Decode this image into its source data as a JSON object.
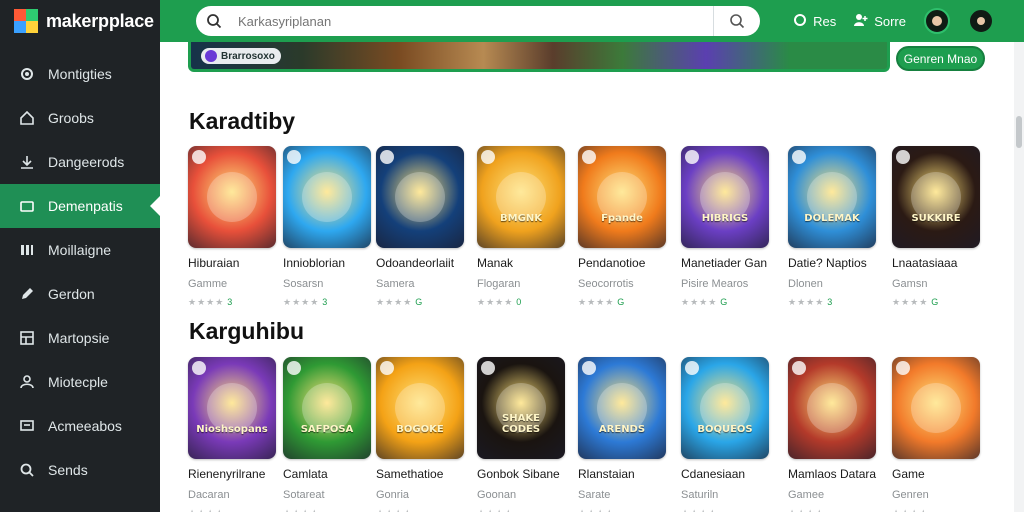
{
  "brand": {
    "name": "makerpplace"
  },
  "sidebar": {
    "items": [
      {
        "label": "Montigties",
        "icon": "settings-icon"
      },
      {
        "label": "Groobs",
        "icon": "home-icon"
      },
      {
        "label": "Dangeerods",
        "icon": "download-icon"
      },
      {
        "label": "Demenpatis",
        "icon": "folder-icon",
        "active": true
      },
      {
        "label": "Moillaigne",
        "icon": "library-icon"
      },
      {
        "label": "Gerdon",
        "icon": "pen-icon"
      },
      {
        "label": "Martopsie",
        "icon": "grid-icon"
      },
      {
        "label": "Miotecple",
        "icon": "people-icon"
      },
      {
        "label": "Acmeeabos",
        "icon": "chat-icon"
      },
      {
        "label": "Sends",
        "icon": "search-icon"
      }
    ]
  },
  "topbar": {
    "search_placeholder": "Karkasyriplanan",
    "links": [
      {
        "label": "Res",
        "icon": "circle-icon"
      },
      {
        "label": "Sorre",
        "icon": "user-plus-icon"
      }
    ]
  },
  "banner": {
    "chip": "Brarrosoxo",
    "button": "Genren Mnao"
  },
  "sections": [
    {
      "title": "Karadtiby",
      "cards": [
        {
          "title": "Hiburaian",
          "sub": "Gamme",
          "stars": "★★★★",
          "num": "3",
          "art": ""
        },
        {
          "title": "Innioblorian",
          "sub": "Sosarsn",
          "stars": "★★★★",
          "num": "3",
          "art": ""
        },
        {
          "title": "Odoandeorlaiit",
          "sub": "Samera",
          "stars": "★★★★",
          "num": "G",
          "art": ""
        },
        {
          "title": "Manak",
          "sub": "Flogaran",
          "stars": "★★★★",
          "num": "0",
          "art": "BMGNK"
        },
        {
          "title": "Pendanotioe",
          "sub": "Seocorrotis",
          "stars": "★★★★",
          "num": "G",
          "art": "Fpande"
        },
        {
          "title": "Manetiader Gan",
          "sub": "Pisire Mearos",
          "stars": "★★★★",
          "num": "G",
          "art": "HIBRIGS"
        },
        {
          "title": "Datie? Naptios",
          "sub": "Dlonen",
          "stars": "★★★★",
          "num": "3",
          "art": "DOLEMAK"
        },
        {
          "title": "Lnaatasiaaa",
          "sub": "Gamsn",
          "stars": "★★★★",
          "num": "G",
          "art": "SUKKIRE"
        }
      ]
    },
    {
      "title": "Karguhibu",
      "cards": [
        {
          "title": "Rienenyrilrane",
          "sub": "Dacaran",
          "stars": "★★★★",
          "num": "",
          "art": "Nioshsopans"
        },
        {
          "title": "Camlata",
          "sub": "Sotareat",
          "stars": "★★★★",
          "num": "",
          "art": "SAFPOSA"
        },
        {
          "title": "Samethatioe",
          "sub": "Gonria",
          "stars": "★★★★",
          "num": "",
          "art": "BOGOKE"
        },
        {
          "title": "Gonbok Sibane",
          "sub": "Goonan",
          "stars": "★★★★",
          "num": "",
          "art": "SHAKE CODES"
        },
        {
          "title": "Rlanstaian",
          "sub": "Sarate",
          "stars": "★★★★",
          "num": "",
          "art": "ARENDS"
        },
        {
          "title": "Cdanesiaan",
          "sub": "Saturiln",
          "stars": "★★★★",
          "num": "",
          "art": "BOQUEOS"
        },
        {
          "title": "Mamlaos Datara",
          "sub": "Gamee",
          "stars": "★★★★",
          "num": "",
          "art": ""
        },
        {
          "title": "Game",
          "sub": "Genren",
          "stars": "★★★★",
          "num": "",
          "art": ""
        }
      ]
    }
  ],
  "colors": {
    "accent": "#1e9e4f",
    "sidebar_bg": "#1f2326",
    "thumbs": [
      "#e8503a",
      "#2ea8f0",
      "#14407a",
      "#f0a21e",
      "#f07b1c",
      "#6b3fc4",
      "#2f8fd8",
      "#2b1a14",
      "#7a3ab8",
      "#2f9a34",
      "#f4a216",
      "#1a1410",
      "#2d7ad6",
      "#2aa6e8",
      "#b43a2a",
      "#f27a2a"
    ]
  }
}
